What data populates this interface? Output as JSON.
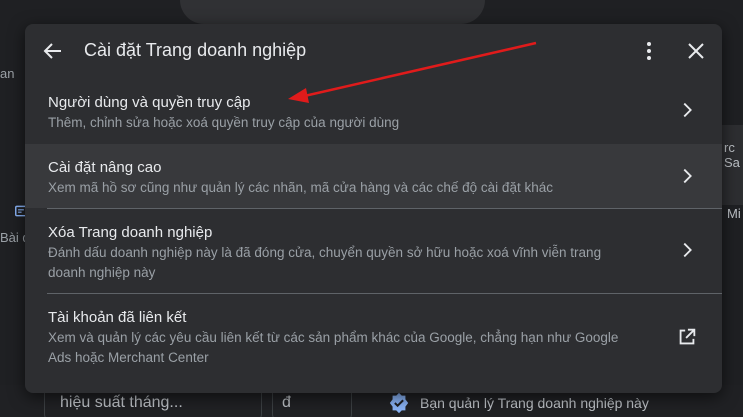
{
  "background": {
    "left_top_text": "an",
    "left_mid_text": "Bài đ",
    "right_top_text": "rc Sa",
    "right_mid_text": "Mi",
    "bottom_field_1": "hiệu suất tháng...",
    "bottom_field_2": "đ",
    "verified_text": "Bạn quản lý Trang doanh nghiệp này"
  },
  "dialog": {
    "title": "Cài đặt Trang doanh nghiệp",
    "items": [
      {
        "title": "Người dùng và quyền truy cập",
        "description": "Thêm, chỉnh sửa hoặc xoá quyền truy cập của người dùng",
        "action_icon": "chevron-right-icon"
      },
      {
        "title": "Cài đặt nâng cao",
        "description": "Xem mã hồ sơ cũng như quản lý các nhãn, mã cửa hàng và các chế độ cài đặt khác",
        "action_icon": "chevron-right-icon"
      },
      {
        "title": "Xóa Trang doanh nghiệp",
        "description": "Đánh dấu doanh nghiệp này là đã đóng cửa, chuyển quyền sở hữu hoặc xoá vĩnh viễn trang doanh nghiệp này",
        "action_icon": "chevron-right-icon"
      },
      {
        "title": "Tài khoản đã liên kết",
        "description": "Xem và quản lý các yêu cầu liên kết từ các sản phẩm khác của Google, chẳng hạn như Google Ads hoặc Merchant Center",
        "action_icon": "open-in-new-icon"
      }
    ]
  },
  "colors": {
    "dialog_bg": "#2d2e31",
    "highlight_row": "#38393c",
    "annotation_arrow": "#e01b1b",
    "verified_badge": "#8ab4f8"
  }
}
